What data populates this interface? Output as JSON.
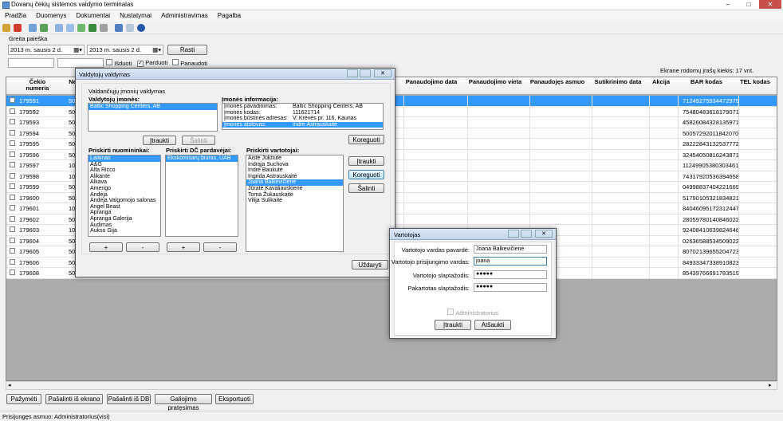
{
  "window": {
    "title": "Dovanų čekių sistemos valdymo terminalas",
    "controls": [
      "–",
      "□",
      "✕"
    ]
  },
  "menu": [
    "Pradžia",
    "Duomenys",
    "Dokumentai",
    "Nustatymai",
    "Administravimas",
    "Pagalba"
  ],
  "toolbar_icons": [
    "edit-icon",
    "delete-icon",
    "search-icon",
    "refresh-icon",
    "copy-icon",
    "paste-icon",
    "add-icon",
    "export-icon",
    "print-icon",
    "zoom-icon",
    "preview-icon",
    "help-icon"
  ],
  "search": {
    "title": "Greita paieška",
    "from_date": "2013 m.  sausis    2 d.",
    "to_date": "2013 m.  sausis    2 d.",
    "find_button": "Rasti",
    "issued_label": "Išduoti",
    "sold_label": "Parduoti",
    "used_label": "Panaudoti",
    "sold_checked": true
  },
  "rows_count_label": "Ekrane rodomų įrašų kiekis: 17 vnt.",
  "grid": {
    "columns_left": [
      "Čekio numeris",
      "Ne"
    ],
    "columns_right": [
      "Panaudojimo data",
      "Panaudojimo vieta",
      "Panaudojęs asmuo",
      "Sutikrinimo data",
      "Akcija",
      "BAR kodas",
      "TEL kodas"
    ],
    "rows": [
      {
        "num": "179591",
        "n": "50",
        "bar": "71249275934472975",
        "selected": true
      },
      {
        "num": "179592",
        "n": "50",
        "bar": "75480483618179071"
      },
      {
        "num": "179593",
        "n": "50",
        "bar": "45826084328135971"
      },
      {
        "num": "179594",
        "n": "50",
        "bar": "50057292011842070"
      },
      {
        "num": "179595",
        "n": "50",
        "bar": "28222843132537772"
      },
      {
        "num": "179596",
        "n": "50",
        "bar": "32454050816243871"
      },
      {
        "num": "179597",
        "n": "10",
        "bar": "11249905380303461"
      },
      {
        "num": "179598",
        "n": "10",
        "bar": "74317920536394658"
      },
      {
        "num": "179599",
        "n": "50",
        "bar": "04998837404221669"
      },
      {
        "num": "179600",
        "n": "50",
        "bar": "51790105321834821"
      },
      {
        "num": "179601",
        "n": "10",
        "bar": "84046095172312447"
      },
      {
        "num": "179602",
        "n": "50",
        "bar": "28059780140846022"
      },
      {
        "num": "179603",
        "n": "10",
        "bar": "92408410639824646"
      },
      {
        "num": "179604",
        "n": "50",
        "bar": "02636588534509022"
      },
      {
        "num": "179605",
        "n": "50",
        "bar": "80702139655204723"
      },
      {
        "num": "179606",
        "n": "50",
        "bar": "84933347338910823"
      },
      {
        "num": "179608",
        "n": "50",
        "bar": "85439766691783519"
      }
    ]
  },
  "bottom_buttons": [
    "Pažymėti",
    "Pašalinti iš ekrano",
    "Pašalinti iš DB",
    "Galiojimo pratęsimas",
    "Eksportuoti"
  ],
  "status": "Prisijungęs asmuo: Administratorius(visi)",
  "admins": {
    "title": "Valdytojų valdymas",
    "group_label": "Valdančiųjų įmonių valdymas",
    "companies_label": "Valdytojų įmonės:",
    "companies": [
      "Baltic Shopping Centers, AB"
    ],
    "add": "Įtraukti",
    "remove": "Šalinti",
    "edit": "Koreguoti",
    "info_label": "Įmonės informacija:",
    "info": [
      {
        "k": "Įmonės pavadinimas:",
        "v": "Baltic Shopping Centers, AB"
      },
      {
        "k": "Įmonės kodas:",
        "v": "111621714"
      },
      {
        "k": "Įmonės būstinės adresas:",
        "v": "V. Krėvės pr. 116, Kaunas"
      },
      {
        "k": "Įmonės atstovas:",
        "v": "Indrė Astrauskaitė"
      }
    ],
    "tenants_label": "Priskirti nuomininkai:",
    "tenants": [
      "Laikinas",
      "A&G",
      "Alfa Ricco",
      "Alikante",
      "Alkava",
      "Amerigo",
      "Andėja",
      "Andėja Valgomojo salonas",
      "Angel Beast",
      "Apranga",
      "Apranga Galerija",
      "Audimas",
      "Aukso Gija"
    ],
    "points_label": "Priskirti DČ pardavėjai:",
    "points": [
      "Ekskomisarų biuras, UAB"
    ],
    "users_label": "Priskirti vartotojai:",
    "users": [
      "Aistė Juknutė",
      "Indrąja Suchova",
      "Indrė Baukutė",
      "Ingrida Astrauskaitė",
      "Joana Balkevičienė",
      "Jūratė Kavaliauskienė",
      "Toma Žukauskaitė",
      "Vilija Sulikaitė"
    ],
    "plus": "+",
    "minus": "-",
    "close": "Uždaryti"
  },
  "user": {
    "title": "Vartotojas",
    "name_label": "Vartotojo vardas pavardė:",
    "name": "Joana Balkevičienė",
    "login_label": "Vartotojo prisijungimo vardas:",
    "login": "joana",
    "pass_label": "Vartotojo slaptažodis:",
    "pass": "●●●●●",
    "pass2_label": "Pakartotas slaptažodis:",
    "pass2": "●●●●●",
    "admin_label": "Administratorius",
    "ok": "Įtraukti",
    "cancel": "Atšaukti"
  }
}
